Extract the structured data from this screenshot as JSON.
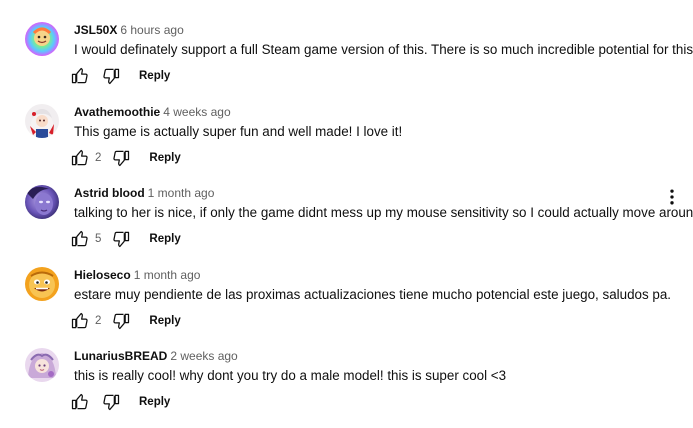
{
  "comments": [
    {
      "author": "JSL50X",
      "time": "6 hours ago",
      "text": "I would definately support a full Steam game version of this. There is so much incredible potential for this.",
      "likes": "",
      "reply_label": "Reply",
      "avatar_icon": "rainbow-portrait-avatar"
    },
    {
      "author": "Avathemoothie",
      "time": "4 weeks ago",
      "text": "This game is actually super fun and well made! I love it!",
      "likes": "2",
      "reply_label": "Reply",
      "avatar_icon": "anime-character-avatar"
    },
    {
      "author": "Astrid blood",
      "time": "1 month ago",
      "text": "talking to her is nice, if only the game didnt mess up my mouse sensitivity so I could actually move around. :(",
      "likes": "5",
      "reply_label": "Reply",
      "avatar_icon": "purple-face-avatar",
      "show_menu": true
    },
    {
      "author": "Hieloseco",
      "time": "1 month ago",
      "text": "estare muy pendiente de las proximas actualizaciones tiene mucho potencial este juego, saludos pa.",
      "likes": "2",
      "reply_label": "Reply",
      "avatar_icon": "cartoon-face-avatar"
    },
    {
      "author": "LunariusBREAD",
      "time": "2 weeks ago",
      "text": "this is really cool! why dont you try do a male model! this is super cool <3",
      "likes": "",
      "reply_label": "Reply",
      "avatar_icon": "pastel-character-avatar"
    }
  ],
  "icons": {
    "like": "thumbs-up-icon",
    "dislike": "thumbs-down-icon",
    "menu": "more-vertical-icon"
  },
  "colors": {
    "text_primary": "#0f0f0f",
    "text_secondary": "#606060"
  }
}
